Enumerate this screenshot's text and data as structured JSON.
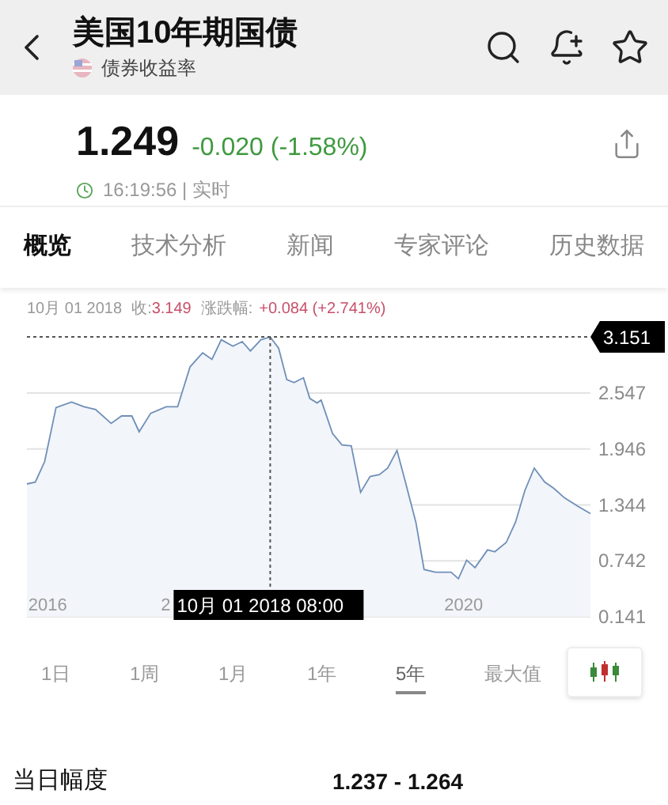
{
  "header": {
    "title": "美国10年期国债",
    "subtitle": "债券收益率"
  },
  "quote": {
    "price": "1.249",
    "change": "-0.020 (-1.58%)",
    "time": "16:19:56 | 实时"
  },
  "tabs": [
    {
      "label": "概览",
      "selected": true
    },
    {
      "label": "技术分析",
      "selected": false
    },
    {
      "label": "新闻",
      "selected": false
    },
    {
      "label": "专家评论",
      "selected": false
    },
    {
      "label": "历史数据",
      "selected": false
    }
  ],
  "chart": {
    "info": {
      "date": "10月 01 2018",
      "close_label": "收:",
      "close": "3.149",
      "change_label": "涨跌幅:",
      "change": "+0.084 (+2.741%)"
    },
    "crosshair": {
      "date_label": "10月 01 2018 08:00",
      "value_label": "3.151",
      "covered_tick_label": "2"
    },
    "chart_data": {
      "type": "area",
      "grid": true,
      "x": [
        2015.8,
        2015.88,
        2015.97,
        2016.08,
        2016.23,
        2016.35,
        2016.46,
        2016.61,
        2016.71,
        2016.81,
        2016.88,
        2016.99,
        2017.14,
        2017.25,
        2017.37,
        2017.49,
        2017.58,
        2017.67,
        2017.78,
        2017.87,
        2017.95,
        2018.05,
        2018.14,
        2018.22,
        2018.3,
        2018.37,
        2018.46,
        2018.52,
        2018.59,
        2018.63,
        2018.74,
        2018.83,
        2018.92,
        2019.01,
        2019.1,
        2019.19,
        2019.27,
        2019.36,
        2019.44,
        2019.54,
        2019.62,
        2019.73,
        2019.88,
        2019.95,
        2020.03,
        2020.11,
        2020.23,
        2020.3,
        2020.41,
        2020.5,
        2020.59,
        2020.68,
        2020.78,
        2020.87,
        2020.97,
        2021.1,
        2021.22
      ],
      "series": [
        {
          "color": "#6f8fb8",
          "values": [
            1.57,
            1.59,
            1.81,
            2.39,
            2.45,
            2.4,
            2.37,
            2.22,
            2.3,
            2.3,
            2.13,
            2.33,
            2.4,
            2.4,
            2.83,
            2.98,
            2.91,
            3.12,
            3.05,
            3.1,
            3.0,
            3.12,
            3.15,
            3.03,
            2.69,
            2.66,
            2.71,
            2.49,
            2.44,
            2.47,
            2.11,
            1.99,
            1.98,
            1.48,
            1.65,
            1.67,
            1.74,
            1.93,
            1.59,
            1.16,
            0.65,
            0.62,
            0.62,
            0.55,
            0.75,
            0.67,
            0.86,
            0.84,
            0.94,
            1.16,
            1.5,
            1.74,
            1.59,
            1.52,
            1.42,
            1.33,
            1.25
          ]
        }
      ],
      "xlim": [
        2015.8,
        2021.22
      ],
      "ylim": [
        0.141,
        3.151
      ],
      "xticks": [
        2016,
        2020
      ],
      "yticks": [
        2.547,
        1.946,
        1.344,
        0.742,
        0.141
      ],
      "ref_lines": [
        {
          "axis": "x",
          "value": 2018.14
        },
        {
          "axis": "y",
          "value": 3.151
        }
      ]
    }
  },
  "ranges": [
    {
      "label": "1日",
      "selected": false
    },
    {
      "label": "1周",
      "selected": false
    },
    {
      "label": "1月",
      "selected": false
    },
    {
      "label": "1年",
      "selected": false
    },
    {
      "label": "5年",
      "selected": true
    },
    {
      "label": "最大值",
      "selected": false
    }
  ],
  "stats": [
    {
      "label": "当日幅度",
      "value": "1.237 - 1.264"
    }
  ]
}
